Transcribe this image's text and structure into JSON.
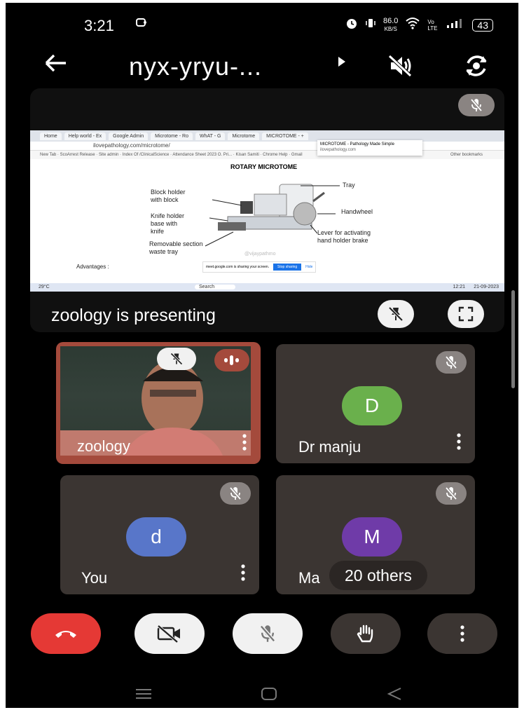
{
  "status_bar": {
    "time": "3:21",
    "net_speed_value": "86.0",
    "net_speed_unit": "KB/S",
    "volte": "Vo LTE",
    "battery": "43"
  },
  "top_bar": {
    "meeting_code": "nyx-yryu-..."
  },
  "presentation": {
    "presenting_text": "zoology is presenting",
    "shared_screen": {
      "tabs": [
        "Home",
        "Help world - Ex",
        "Google Admin",
        "Microtome - Ro",
        "WhAT - G",
        "Microtome",
        "MICROTOME - +"
      ],
      "url": "ilovepathology.com/microtome/",
      "tooltip_title": "MICROTOME - Pathology Made Simple",
      "tooltip_url": "ilovepathology.com",
      "bookmarks": [
        "New Tab",
        "ScoArrest Release",
        "Site admin",
        "Index Of /ClinicalScience",
        "Attendance Sheet 2023 O. Pri...",
        "Kisan Samiti",
        "Chrome Help",
        "Gmail",
        "Other bookmarks"
      ],
      "heading": "ROTARY MICROTOME",
      "labels": {
        "tray": "Tray",
        "block_holder_1": "Block holder",
        "block_holder_2": "with block",
        "handwheel": "Handwheel",
        "knife_holder_1": "Knife holder",
        "knife_holder_2": "base with",
        "knife_holder_3": "knife",
        "lever_1": "Lever  for activating",
        "lever_2": "hand holder brake",
        "waste_1": "Removable section",
        "waste_2": "waste tray",
        "advantages": "Advantages :",
        "watermark": "@vijaypathmo"
      },
      "share_notice": "meet.google.com is sharing your screen.",
      "stop_sharing": "Stop sharing",
      "hide": "Hide",
      "taskbar_search": "Search",
      "weather": "29°C",
      "clock": "12:21",
      "date": "21-09-2023"
    }
  },
  "participants": [
    {
      "name": "zoology",
      "initial": "",
      "avatar_color": "",
      "has_video": true
    },
    {
      "name": "Dr manju",
      "initial": "D",
      "avatar_color": "#6ab04c",
      "has_video": false
    },
    {
      "name": "You",
      "initial": "d",
      "avatar_color": "#5876c9",
      "has_video": false
    },
    {
      "name": "Ma",
      "initial": "M",
      "avatar_color": "#6f3ba8",
      "has_video": false
    }
  ],
  "others_chip": "20 others",
  "colors": {
    "end_call": "#e53935",
    "tile_bg": "#3b3532",
    "speaking_border": "#a44a3c"
  }
}
